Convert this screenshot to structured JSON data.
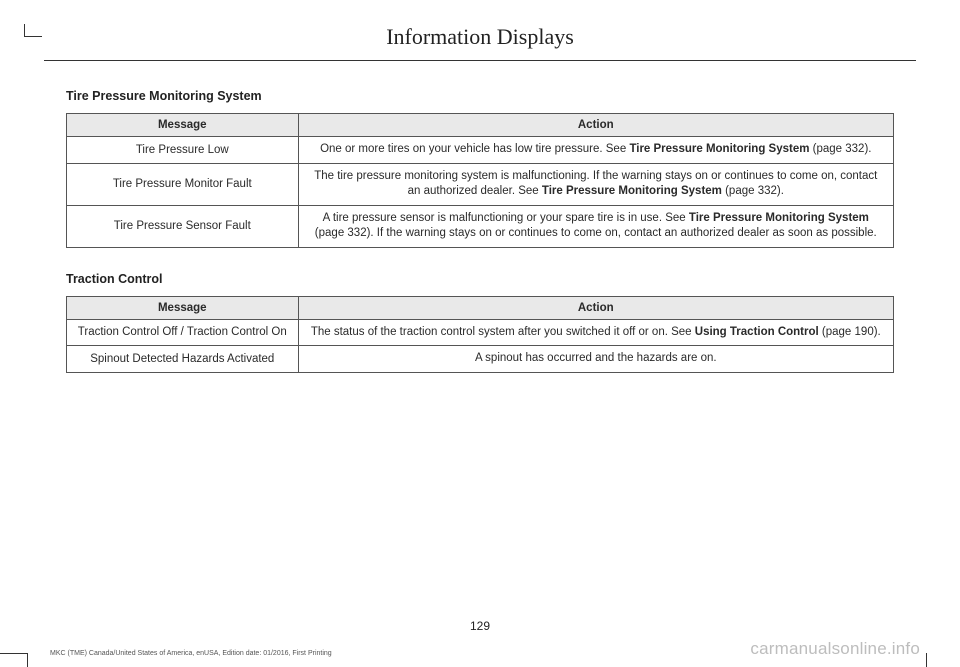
{
  "page": {
    "title": "Information Displays",
    "number": "129",
    "footer_left": "MKC (TME) Canada/United States of America, enUSA, Edition date: 01/2016, First Printing",
    "watermark": "carmanualsonline.info"
  },
  "table_headers": {
    "message": "Message",
    "action": "Action"
  },
  "sections": [
    {
      "heading": "Tire Pressure Monitoring System",
      "rows": [
        {
          "message": "Tire Pressure Low",
          "action_pre": "One or more tires on your vehicle has low tire pressure.  See ",
          "action_bold": "Tire Pressure Monitoring System",
          "action_post": " (page 332)."
        },
        {
          "message": "Tire Pressure Monitor Fault",
          "action_pre": "The tire pressure monitoring system is malfunctioning. If the warning stays on or continues to come on, contact an authorized dealer. See ",
          "action_bold": "Tire Pressure Monitoring System",
          "action_post": " (page 332)."
        },
        {
          "message": "Tire Pressure Sensor Fault",
          "action_pre": "A tire pressure sensor is malfunctioning or your spare tire is in use.  See ",
          "action_bold": "Tire Pressure Monitoring System",
          "action_post": " (page 332).  If the warning stays on or continues to come on, contact an authorized dealer as soon as possible."
        }
      ]
    },
    {
      "heading": "Traction Control",
      "rows": [
        {
          "message": "Traction Control Off / Traction Control On",
          "action_pre": "The status of the traction control system after you switched it off or on.  See ",
          "action_bold": "Using Traction Control",
          "action_post": " (page 190)."
        },
        {
          "message": "Spinout Detected Hazards Activated",
          "action_pre": "A spinout has occurred and the hazards are on.",
          "action_bold": "",
          "action_post": ""
        }
      ]
    }
  ]
}
